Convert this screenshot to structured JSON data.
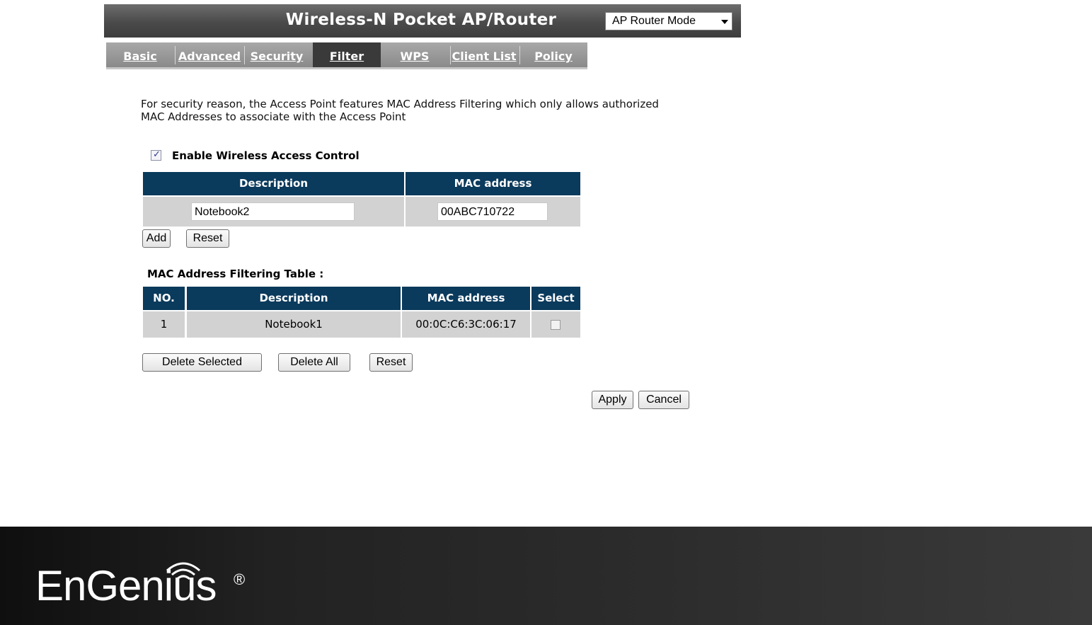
{
  "header": {
    "title": "Wireless-N Pocket AP/Router",
    "mode_select": {
      "value": "AP Router Mode"
    }
  },
  "tabs": [
    {
      "label": "Basic",
      "active": false
    },
    {
      "label": "Advanced",
      "active": false
    },
    {
      "label": "Security",
      "active": false
    },
    {
      "label": "Filter",
      "active": true
    },
    {
      "label": "WPS",
      "active": false
    },
    {
      "label": "Client List",
      "active": false
    },
    {
      "label": "Policy",
      "active": false
    }
  ],
  "intro": {
    "line1": "For security reason, the Access Point features MAC Address Filtering which only allows authorized",
    "line2": "MAC Addresses to associate with the Access Point"
  },
  "enable_control": {
    "label": "Enable Wireless Access Control",
    "checked": true
  },
  "entry_form": {
    "col_description": "Description",
    "col_mac": "MAC address",
    "description_value": "Notebook2",
    "mac_value": "00ABC710722",
    "add_label": "Add",
    "reset_label": "Reset"
  },
  "filter_table": {
    "title": "MAC Address Filtering Table :",
    "columns": [
      "NO.",
      "Description",
      "MAC address",
      "Select"
    ],
    "rows": [
      {
        "no": "1",
        "description": "Notebook1",
        "mac": "00:0C:C6:3C:06:17",
        "selected": false
      }
    ],
    "delete_selected_label": "Delete Selected",
    "delete_all_label": "Delete All",
    "reset_label": "Reset"
  },
  "actions": {
    "apply_label": "Apply",
    "cancel_label": "Cancel"
  },
  "footer": {
    "brand": "EnGenius",
    "registered": "®"
  },
  "colors": {
    "table_header": "#0a3a5c",
    "header_bar": "#4a4a4a",
    "cell_bg": "#d2d2d2"
  }
}
